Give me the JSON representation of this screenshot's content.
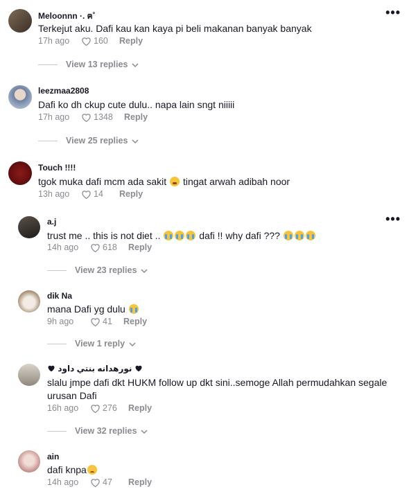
{
  "comments": [
    {
      "username": "Meloonnn ·. ฅ˚",
      "text": "Terkejut aku. Dafi kau kan kaya pi beli makanan banyak banyak",
      "time": "17h ago",
      "likes": "160",
      "reply_label": "Reply",
      "view_replies": "View 13 replies",
      "avatar_color": "#5b4a3a"
    },
    {
      "username": "leezmaa2808",
      "text": "Dafi ko dh ckup cute dulu.. napa lain sngt niiiii",
      "time": "17h ago",
      "likes": "1348",
      "reply_label": "Reply",
      "view_replies": "View 25 replies",
      "avatar_color": "#9aa6b8"
    },
    {
      "username": "Touch !!!!",
      "text_before": "tgok muka dafi mcm ada sakit",
      "text_after": "tingat arwah adibah noor",
      "time": "13h ago",
      "likes": "14",
      "reply_label": "Reply",
      "avatar_color": "#6b0d0d"
    },
    {
      "username": "a.j",
      "text_a": "trust me .. this is not diet ..",
      "text_b": "dafi !! why dafi ???",
      "time": "14h ago",
      "likes": "618",
      "reply_label": "Reply",
      "view_replies": "View 23 replies",
      "avatar_color": "#3a3530"
    },
    {
      "username": "dik Na",
      "text": "mana Dafi yg dulu",
      "time": "9h ago",
      "likes": "41",
      "reply_label": "Reply",
      "view_replies": "View 1 reply",
      "avatar_color": "#c9b8a0"
    },
    {
      "username": "نورهدانه بنتي داود",
      "text_line1": "slalu jmpe dafi dkt HUKM follow up dkt sini..semoge Allah permudahkan segale",
      "text_line2": "urusan Dafi",
      "time": "16h ago",
      "likes": "276",
      "reply_label": "Reply",
      "view_replies": "View 32 replies",
      "avatar_color": "#b7b2a8"
    },
    {
      "username": "ain",
      "text": "dafi knpa",
      "time": "14h ago",
      "likes": "47",
      "reply_label": "Reply",
      "avatar_color": "#d8c6c0"
    }
  ],
  "more_label": "•••"
}
